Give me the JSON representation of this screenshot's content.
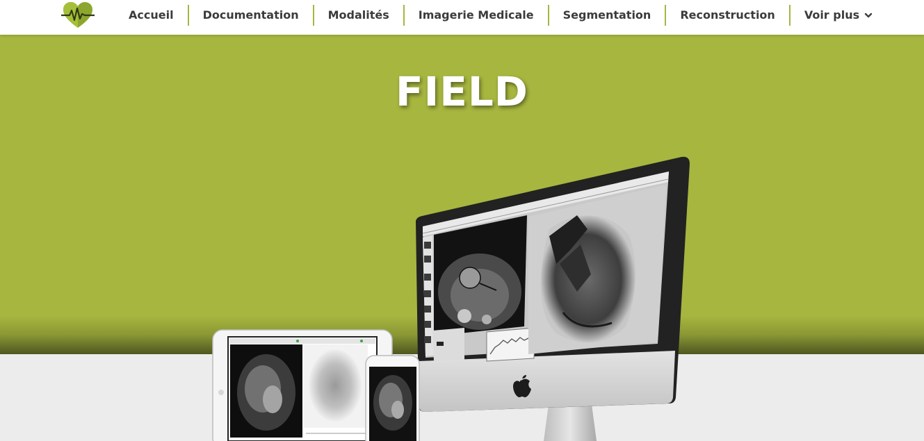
{
  "nav": {
    "items": [
      {
        "label": "Accueil"
      },
      {
        "label": "Documentation"
      },
      {
        "label": "Modalités"
      },
      {
        "label": "Imagerie Medicale"
      },
      {
        "label": "Segmentation"
      },
      {
        "label": "Reconstruction"
      },
      {
        "label": "Voir plus"
      }
    ],
    "more_icon": "chevron-down-icon",
    "logo_icon": "heart-pulse-icon"
  },
  "hero": {
    "title": "FIELD"
  },
  "colors": {
    "accent": "#a7b63f",
    "nav_text": "#3b3b3b",
    "divider": "#a5b63d"
  }
}
